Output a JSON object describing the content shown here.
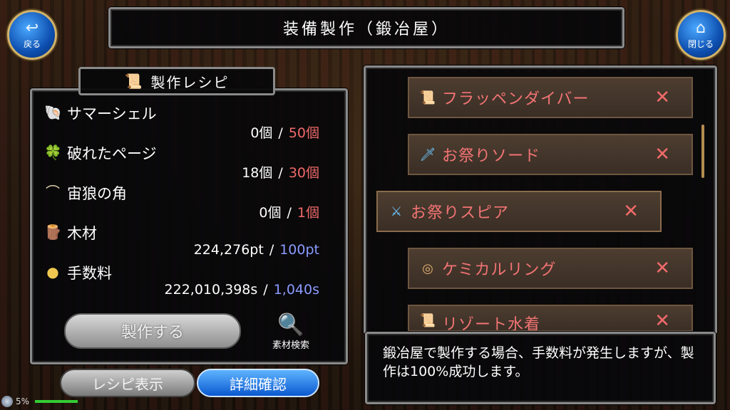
{
  "header": {
    "title": "装備製作（鍛冶屋）"
  },
  "nav": {
    "back_label": "戻る",
    "back_icon": "undo-arrow-icon",
    "close_label": "閉じる",
    "close_icon": "home-icon"
  },
  "recipe": {
    "title": "製作レシピ",
    "materials": [
      {
        "name": "サマーシェル",
        "icon": "shell-icon",
        "have": "0個",
        "need": "50個",
        "need_color": "#f06a6a"
      },
      {
        "name": "破れたページ",
        "icon": "torn-page-icon",
        "have": "18個",
        "need": "30個",
        "need_color": "#f06a6a"
      },
      {
        "name": "宙狼の角",
        "icon": "horn-icon",
        "have": "0個",
        "need": "1個",
        "need_color": "#f06a6a"
      },
      {
        "name": "木材",
        "icon": "wood-icon",
        "have": "224,276pt",
        "need": "100pt",
        "need_color": "#8a9bff"
      },
      {
        "name": "手数料",
        "icon": "coin-icon",
        "have": "222,010,398s",
        "need": "1,040s",
        "need_color": "#8a9bff"
      }
    ],
    "separator": "/",
    "craft_label": "製作する",
    "search_label": "素材検索",
    "recipe_show_label": "レシピ表示",
    "detail_label": "詳細確認"
  },
  "item_list": [
    {
      "name": "フラッペンダイバー",
      "icon": "scroll-icon",
      "status": "✕"
    },
    {
      "name": "お祭りソード",
      "icon": "sword-icon",
      "status": "✕"
    },
    {
      "name": "お祭りスピア",
      "icon": "spear-icon",
      "status": "✕",
      "selected": true
    },
    {
      "name": "ケミカルリング",
      "icon": "ring-icon",
      "status": "✕"
    },
    {
      "name": "リゾート水着",
      "icon": "scroll-icon",
      "status": "✕"
    }
  ],
  "message": "鍛冶屋で製作する場合、手数料が発生しますが、製作は100%成功します。",
  "status": {
    "percent": "5%"
  }
}
